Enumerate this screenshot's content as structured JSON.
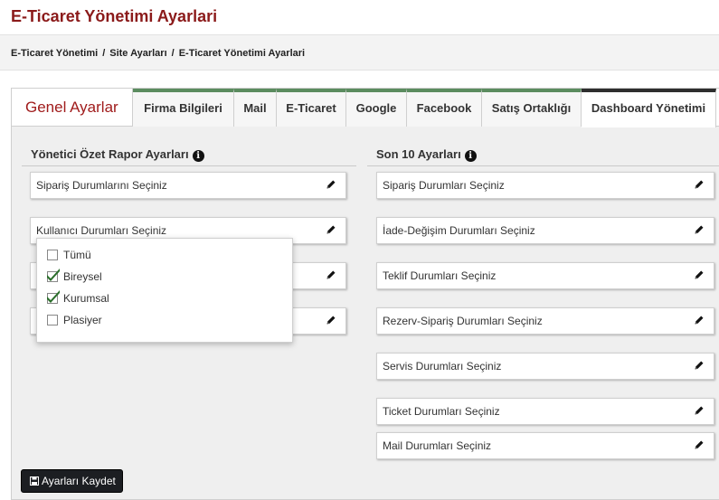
{
  "page": {
    "title": "E-Ticaret Yönetimi Ayarlari"
  },
  "breadcrumb": [
    "E-Ticaret Yönetimi",
    "Site Ayarları",
    "E-Ticaret Yönetimi Ayarlari"
  ],
  "panel": {
    "title": "Genel Ayarlar",
    "tabs": [
      {
        "label": "Firma Bilgileri",
        "active": false
      },
      {
        "label": "Mail",
        "active": false
      },
      {
        "label": "E-Ticaret",
        "active": false
      },
      {
        "label": "Google",
        "active": false
      },
      {
        "label": "Facebook",
        "active": false
      },
      {
        "label": "Satış Ortaklığı",
        "active": false
      },
      {
        "label": "Dashboard Yönetimi",
        "active": true
      }
    ]
  },
  "left_section": {
    "title": "Yönetici Özet Rapor Ayarları",
    "fields": [
      "Sipariş Durumlarını Seçiniz",
      "Kullanıcı Durumları Seçiniz",
      "",
      ""
    ]
  },
  "dropdown": {
    "options": [
      {
        "label": "Tümü",
        "checked": false
      },
      {
        "label": "Bireysel",
        "checked": true
      },
      {
        "label": "Kurumsal",
        "checked": true
      },
      {
        "label": "Plasiyer",
        "checked": false
      }
    ]
  },
  "right_section": {
    "title": "Son 10 Ayarları",
    "fields": [
      "Sipariş Durumları Seçiniz",
      "İade-Değişim Durumları Seçiniz",
      "Teklif Durumları Seçiniz",
      "Rezerv-Sipariş Durumları Seçiniz",
      "Servis Durumları Seçiniz",
      "Ticket Durumları Seçiniz",
      "Mail Durumları Seçiniz"
    ]
  },
  "actions": {
    "save_label": "Ayarları Kaydet"
  },
  "colors": {
    "title_red": "#8b1a1a",
    "tab_green": "#5b8c5f",
    "check_green": "#2a6e2a",
    "button_dark": "#1c1e22"
  },
  "icons": {
    "info": "info-icon",
    "edit": "pencil-icon",
    "save": "floppy-disk-icon",
    "check": "check-icon"
  }
}
